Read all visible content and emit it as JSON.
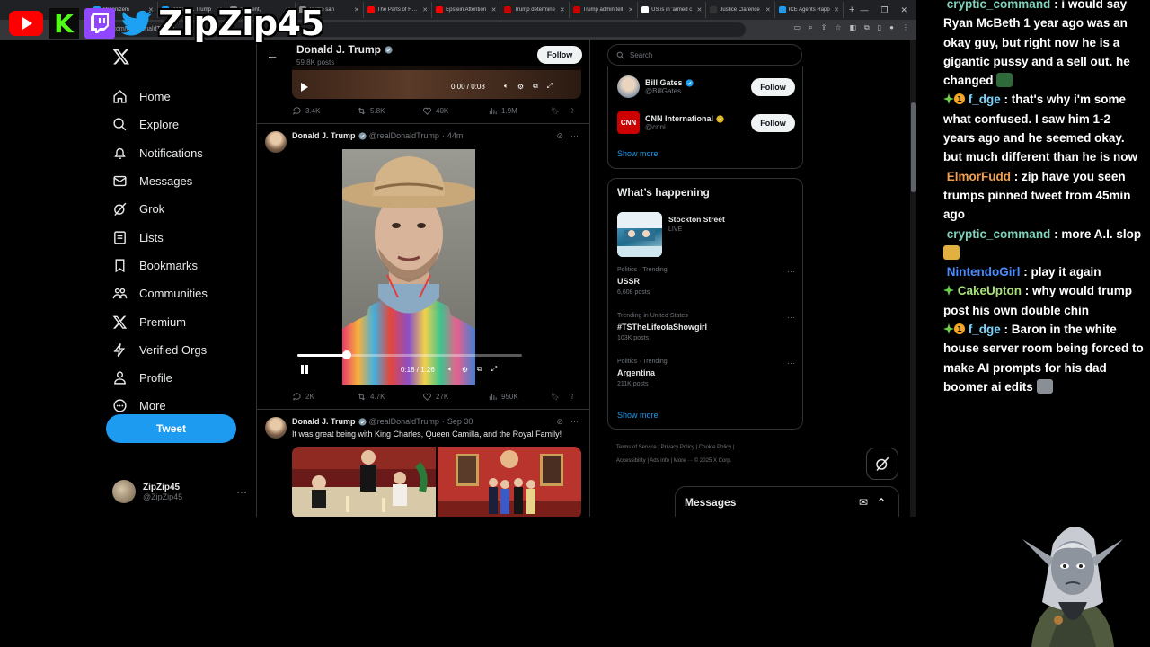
{
  "overlay": {
    "channel_name": "ZipZip45"
  },
  "browser": {
    "tabs": [
      {
        "label": "Organizem",
        "color": "#1d9bf0"
      },
      {
        "label": "Donald J. Trump",
        "color": "#1d9bf0"
      },
      {
        "label": "resident,",
        "color": "#888888"
      },
      {
        "label": "Trump san",
        "color": "#888888"
      },
      {
        "label": "The Parts of Hegs",
        "color": "#ff0000"
      },
      {
        "label": "Epstein Attention",
        "color": "#ff0000"
      },
      {
        "label": "Trump determine",
        "color": "#cc0000"
      },
      {
        "label": "Trump admin tell",
        "color": "#cc0000"
      },
      {
        "label": "US is in 'armed c",
        "color": "#ffffff"
      },
      {
        "label": "Justice Clarence",
        "color": "#333333"
      },
      {
        "label": "ICE Agents Rapp",
        "color": "#1d9bf0"
      }
    ],
    "new_tab": "+",
    "address": "x.com/realDonaldTrump"
  },
  "nav": {
    "items": [
      {
        "label": "Home",
        "icon": "home-icon"
      },
      {
        "label": "Explore",
        "icon": "search-icon"
      },
      {
        "label": "Notifications",
        "icon": "bell-icon"
      },
      {
        "label": "Messages",
        "icon": "envelope-icon"
      },
      {
        "label": "Grok",
        "icon": "grok-icon"
      },
      {
        "label": "Lists",
        "icon": "list-icon"
      },
      {
        "label": "Bookmarks",
        "icon": "bookmark-icon"
      },
      {
        "label": "Communities",
        "icon": "people-icon"
      },
      {
        "label": "Premium",
        "icon": "x-icon"
      },
      {
        "label": "Verified Orgs",
        "icon": "lightning-icon"
      },
      {
        "label": "Profile",
        "icon": "person-icon"
      },
      {
        "label": "More",
        "icon": "more-circle-icon"
      }
    ],
    "tweet_button": "Tweet",
    "account": {
      "name": "ZipZip45",
      "handle": "@ZipZip45"
    }
  },
  "profile_header": {
    "name": "Donald J. Trump",
    "posts_count": "59.8K posts",
    "follow_label": "Follow"
  },
  "post1": {
    "video_time": "0:00 / 0:08",
    "replies": "3.4K",
    "reposts": "5.8K",
    "likes": "40K",
    "views": "1.9M"
  },
  "post2": {
    "name": "Donald J. Trump",
    "handle": "@realDonaldTrump",
    "time": "44m",
    "video_time": "0:18 / 1:26",
    "video_progress": 0.22,
    "replies": "2K",
    "reposts": "4.7K",
    "likes": "27K",
    "views": "950K"
  },
  "post3": {
    "name": "Donald J. Trump",
    "handle": "@realDonaldTrump",
    "time": "Sep 30",
    "text": "It was great being with King Charles, Queen Camilla, and the Royal Family!"
  },
  "right": {
    "search_placeholder": "Search",
    "who_to_follow": [
      {
        "name": "Bill Gates",
        "handle": "@BillGates",
        "verified": "blue"
      },
      {
        "name": "CNN International",
        "handle": "@cnni",
        "verified": "gold"
      }
    ],
    "follow_label": "Follow",
    "show_more": "Show more",
    "happening_title": "What’s happening",
    "live": {
      "name": "Stockton Street",
      "tag": "LIVE"
    },
    "trends": [
      {
        "context": "Politics · Trending",
        "name": "USSR",
        "count": "6,608 posts"
      },
      {
        "context": "Trending in United States",
        "name": "#TSTheLifeofaShowgirl",
        "count": "103K posts"
      },
      {
        "context": "Politics · Trending",
        "name": "Argentina",
        "count": "211K posts"
      }
    ],
    "show_more_2": "Show more",
    "footer_line1": "Terms of Service  |  Privacy Policy  |  Cookie Policy  |",
    "footer_line2": "Accessibility  |  Ads info  |  More ···  © 2025 X Corp.",
    "messages_label": "Messages"
  },
  "chat": [
    {
      "user": "cryptic_command",
      "color": "#7fd1b9",
      "text": ": i would say Ryan McBeth 1 year ago was an okay guy, but right now he is a gigantic pussy and a sell out. he changed",
      "emote": true
    },
    {
      "user": "f_dge",
      "color": "#7ad6ff",
      "text": ": that's why i'm some what confused. I saw him 1-2 years ago and he seemed okay. but much different than he is now",
      "badges": true
    },
    {
      "user": "ElmorFudd",
      "color": "#f0a050",
      "text": ": zip have you seen trumps pinned tweet from 45min ago"
    },
    {
      "user": "cryptic_command",
      "color": "#7fd1b9",
      "text": ": more A.I. slop",
      "emote": true
    },
    {
      "user": "NintendoGirl",
      "color": "#4a8cff",
      "text": ": play it again"
    },
    {
      "user": "CakeUpton",
      "color": "#a8e07a",
      "text": ": why would trump post his own double chin",
      "badge_green": true
    },
    {
      "user": "f_dge",
      "color": "#7ad6ff",
      "text": ": Baron in the white house server room being forced to make AI prompts for his dad boomer ai edits",
      "badges": true,
      "emote": true
    }
  ]
}
